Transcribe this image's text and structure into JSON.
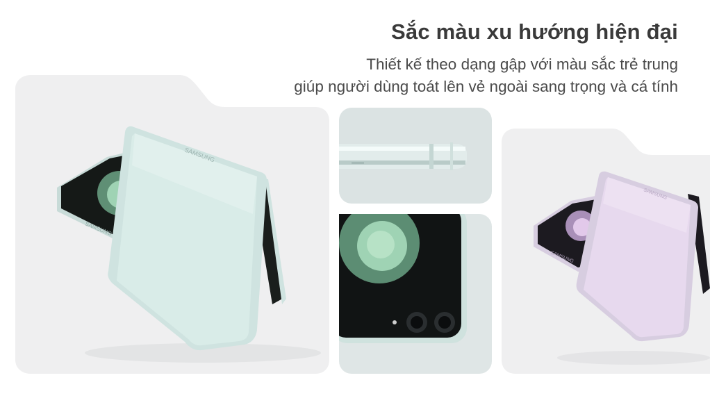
{
  "header": {
    "title": "Sắc màu xu hướng hiện đại",
    "description_line1": "Thiết kế theo dạng gập với màu sắc trẻ trung",
    "description_line2": "giúp người dùng toát lên vẻ ngoài sang trọng và cá tính"
  },
  "images": [
    {
      "name": "mint-flip-phone-standing",
      "colors": {
        "bg": "#efeff0",
        "body": "#d9ece8",
        "frame": "#cfe3e0"
      }
    },
    {
      "name": "mint-phone-hinge-closeup",
      "colors": {
        "bg": "#dbe3e3",
        "frame": "#eaf2f1"
      }
    },
    {
      "name": "mint-cover-screen-closeup",
      "colors": {
        "bg": "#dfe6e6",
        "screen": "#111414",
        "wallpaper": "#9fd3b4"
      }
    },
    {
      "name": "lavender-flip-phone-standing",
      "colors": {
        "bg": "#efeff0",
        "body": "#e7d9ee",
        "frame": "#d7cde0"
      }
    }
  ],
  "brand_marks": [
    "SAMSUNG"
  ]
}
